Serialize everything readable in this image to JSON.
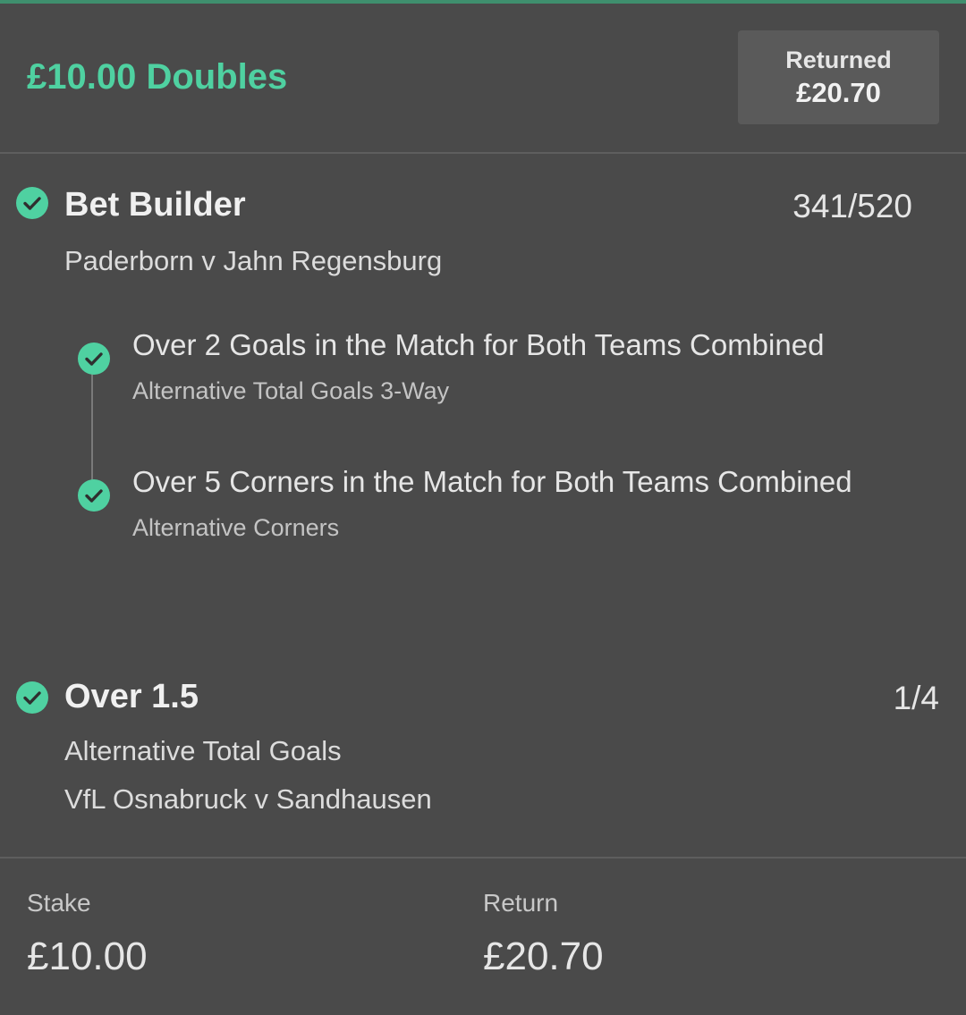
{
  "header": {
    "bet_title": "£10.00 Doubles",
    "returned_label": "Returned",
    "returned_amount": "£20.70"
  },
  "selections": [
    {
      "title": "Bet Builder",
      "odds": "341/520",
      "match": "Paderborn v Jahn Regensburg",
      "status": "won",
      "legs": [
        {
          "title": "Over 2 Goals in the Match for Both Teams Combined",
          "market": "Alternative Total Goals 3-Way",
          "status": "won"
        },
        {
          "title": "Over 5 Corners in the Match for Both Teams Combined",
          "market": "Alternative Corners",
          "status": "won"
        }
      ]
    },
    {
      "title": "Over 1.5",
      "odds": "1/4",
      "market": "Alternative Total Goals",
      "match": "VfL Osnabruck v Sandhausen",
      "status": "won"
    }
  ],
  "footer": {
    "stake_label": "Stake",
    "stake_value": "£10.00",
    "return_label": "Return",
    "return_value": "£20.70"
  },
  "colors": {
    "background": "#4a4a4a",
    "accent": "#4fd1a1",
    "returned_box": "#5a5a5a"
  },
  "icons": {
    "won": "check-circle-icon"
  }
}
